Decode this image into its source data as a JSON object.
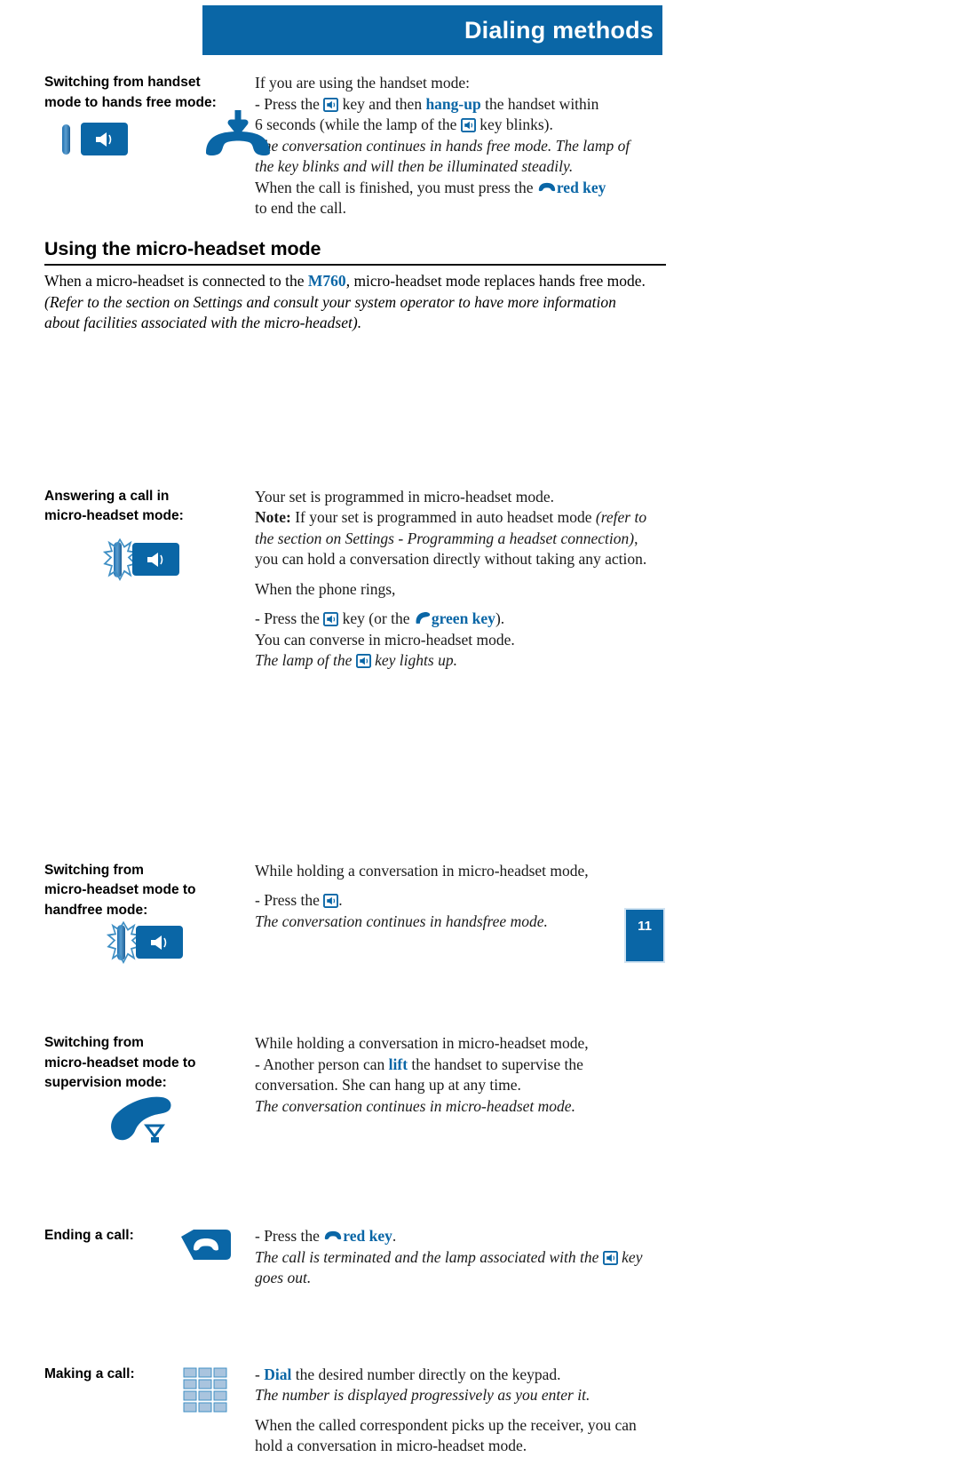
{
  "header": {
    "title": "Dialing methods",
    "band_color": "#0a66a6"
  },
  "page_number": "11",
  "blocks": [
    {
      "id": "switching-handset-to-handsfree",
      "label_lines": [
        "Switching from handset",
        "mode to hands free mode:"
      ],
      "icons": [
        "handsfree-key-icon",
        "hang-up-handset-icon"
      ],
      "body": [
        "If you are using the handset mode:",
        "- Press the [spk] key and then hang-up the handset within",
        "6 seconds (while the lamp of the [spk] key blinks).",
        "The conversation continues in hands free mode. The lamp of",
        "the key blinks and will then be illuminated steadily.",
        "When the call is finished, you must press the [red] red key",
        "to end the call."
      ],
      "body_parts": {
        "l1": "If you are using the handset mode:",
        "l2a": "- Press the ",
        "l2b": " key and then ",
        "l2c": "hang-up",
        "l2d": " the handset within",
        "l3a": "6 seconds (while the lamp of the ",
        "l3b": " key blinks).",
        "l4": "The conversation continues in hands free mode. The lamp of",
        "l5": "the key blinks and will then be illuminated steadily.",
        "l6a": "When the call is finished, you must press the ",
        "l6b": "red key",
        "l7": "to end the call."
      }
    }
  ],
  "section": {
    "heading": "Using the micro-headset mode",
    "intro_parts": {
      "p1a": "When a micro-headset is connected to the ",
      "p1b": "M760",
      "p1c": ", micro-headset mode replaces hands free mode.",
      "p2": "(Refer to the section on Settings and consult  your system operator to have more information",
      "p3": "about facilities associated with the micro-headset)."
    }
  },
  "answering": {
    "label_lines": [
      "Answering a call in",
      "micro-headset mode:"
    ],
    "icon": "blinking-handsfree-key-icon",
    "parts": {
      "l1": "Your set is programmed in micro-headset mode.",
      "l2a": "Note:",
      "l2b": " If your set is programmed in auto headset mode ",
      "l2c": "(refer to",
      "l3": "the section on Settings - Programming a headset connection)",
      "l3b": ",",
      "l4": "you can hold a conversation directly without taking any action.",
      "l5": "When the phone rings,",
      "l6a": "- Press the ",
      "l6b": " key (or the ",
      "l6c": "green key",
      "l6d": ").",
      "l7": "You can converse in micro-headset mode.",
      "l8a": "The lamp of the ",
      "l8b": " key lights up."
    }
  },
  "switching_handsfree": {
    "label_lines": [
      "Switching from",
      "micro-headset mode to",
      "handfree mode:"
    ],
    "icon": "blinking-handsfree-key-icon",
    "parts": {
      "l1": "While holding a conversation in micro-headset mode,",
      "l2a": "- Press the ",
      "l2b": ".",
      "l3": "The conversation continues in handsfree mode."
    }
  },
  "switching_supervision": {
    "label_lines": [
      "Switching from",
      "micro-headset mode to",
      "supervision mode:"
    ],
    "icon": "lift-handset-icon",
    "parts": {
      "l1": "While holding a conversation in micro-headset mode,",
      "l2a": "- Another person can ",
      "l2b": "lift",
      "l2c": " the handset to supervise the",
      "l3": "conversation. She can hang up at any time.",
      "l4": "The conversation continues in micro-headset mode."
    }
  },
  "ending_call": {
    "label": "Ending a call:",
    "icon": "red-key-icon",
    "parts": {
      "l1a": "- Press the ",
      "l1b": "red key",
      "l1c": ".",
      "l2a": "The call is terminated and the lamp associated with the ",
      "l2b": " key",
      "l3": "goes out."
    }
  },
  "making_call": {
    "label": "Making a call:",
    "icon": "keypad-icon",
    "parts": {
      "l1a": "- ",
      "l1b": "Dial",
      "l1c": " the desired number directly on the keypad.",
      "l2": "The number is displayed progressively as you enter it.",
      "l3": "When the called correspondent picks up the receiver, you can",
      "l4": "hold a conversation in micro-headset mode."
    }
  },
  "colors": {
    "accent_blue": "#0a66a6",
    "lamp_blue": "#4d8fc4",
    "keypad_blue": "#a9c4de"
  }
}
